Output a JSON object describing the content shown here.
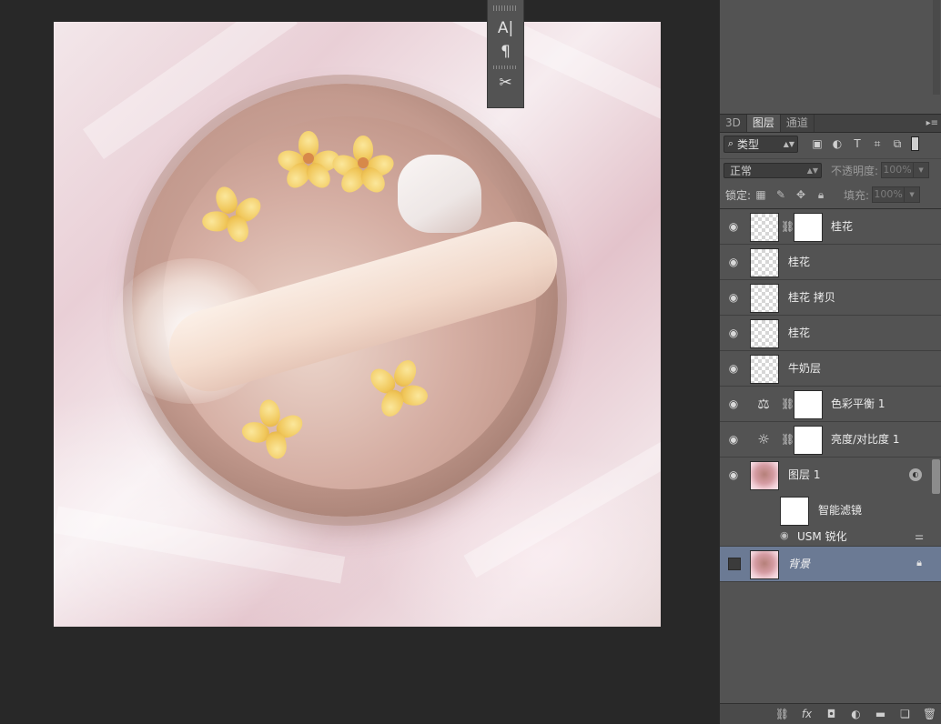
{
  "mini_panel": {
    "char_icon": "A|",
    "para_icon": "¶",
    "tool_icon": "✂"
  },
  "panel_tabs": [
    {
      "label": "3D"
    },
    {
      "label": "图层"
    },
    {
      "label": "通道"
    }
  ],
  "filter": {
    "kind_label": "类型",
    "icons": [
      "image-filter-icon",
      "adjustment-filter-icon",
      "type-filter-icon",
      "shape-filter-icon",
      "smart-object-filter-icon"
    ]
  },
  "blend": {
    "mode": "正常",
    "opacity_label": "不透明度:",
    "opacity_value": "100%",
    "fill_label": "填充:",
    "fill_value": "100%"
  },
  "lock": {
    "label": "锁定:"
  },
  "layers": [
    {
      "name": "桂花",
      "visible": true,
      "type": "masked"
    },
    {
      "name": "桂花",
      "visible": true,
      "type": "pixel"
    },
    {
      "name": "桂花 拷贝",
      "visible": true,
      "type": "pixel"
    },
    {
      "name": "桂花",
      "visible": true,
      "type": "pixel"
    },
    {
      "name": "牛奶层",
      "visible": true,
      "type": "pixel"
    },
    {
      "name": "色彩平衡 1",
      "visible": true,
      "type": "adjustment",
      "icon": "balance-icon"
    },
    {
      "name": "亮度/对比度 1",
      "visible": true,
      "type": "adjustment",
      "icon": "brightness-icon"
    },
    {
      "name": "图层 1",
      "visible": true,
      "type": "smart-object"
    },
    {
      "name": "背景",
      "visible": false,
      "type": "background",
      "selected": true,
      "locked": true
    }
  ],
  "smart_filters": {
    "label": "智能滤镜",
    "filter_name": "USM 锐化"
  },
  "bottom_icons": [
    "link-icon",
    "fx-icon",
    "mask-icon",
    "adjustment-icon",
    "folder-icon",
    "new-layer-icon",
    "trash-icon"
  ]
}
